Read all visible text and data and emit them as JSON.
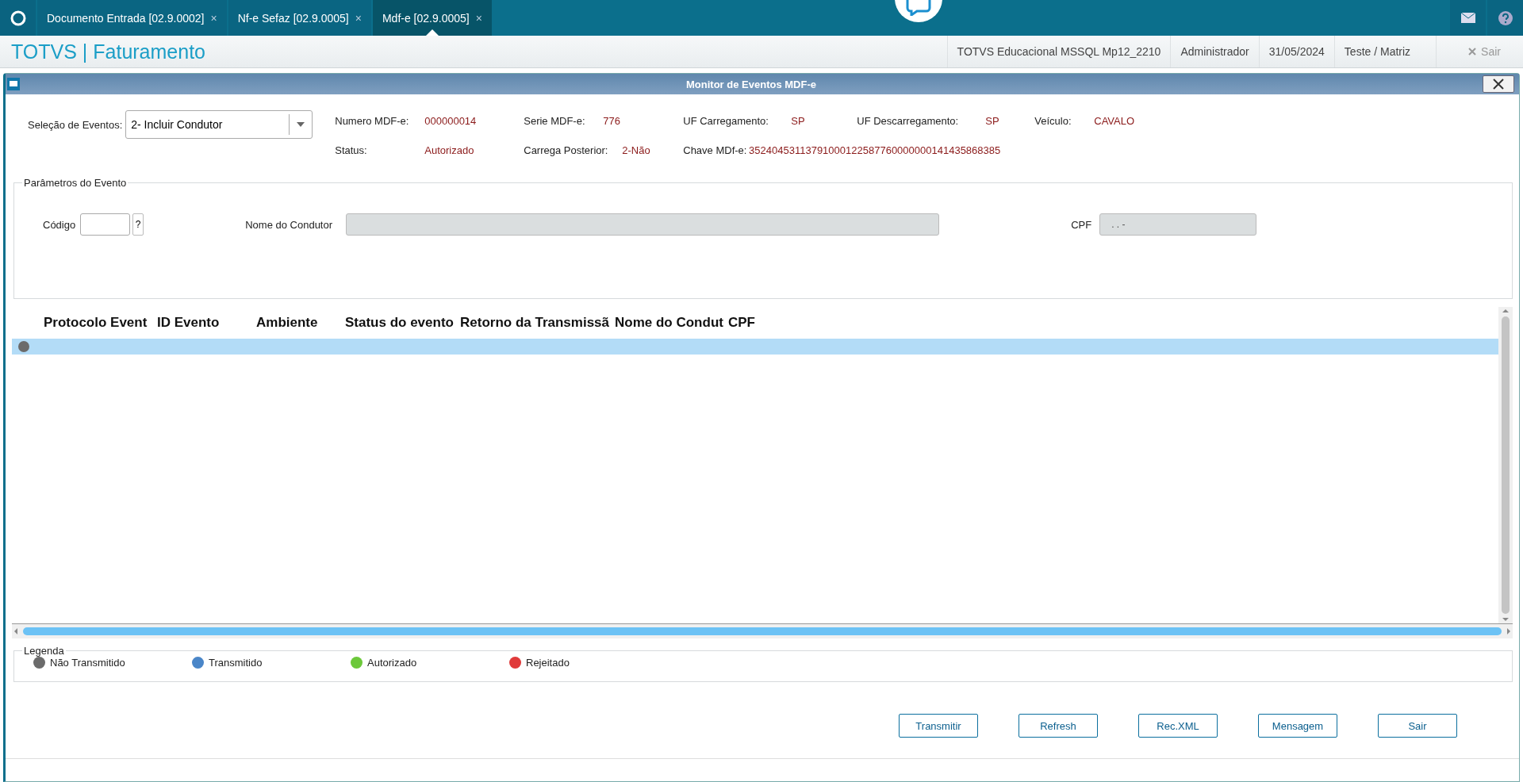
{
  "tabs": [
    {
      "label": "Documento Entrada [02.9.0002]",
      "close": "×",
      "selected": false
    },
    {
      "label": "Nf-e Sefaz [02.9.0005]",
      "close": "×",
      "selected": false
    },
    {
      "label": "Mdf-e [02.9.0005]",
      "close": "×",
      "selected": true
    }
  ],
  "header": {
    "title": "TOTVS | Faturamento",
    "info": [
      "TOTVS Educacional MSSQL Mp12_2210",
      "Administrador",
      "31/05/2024",
      "Teste / Matriz"
    ],
    "exit": "Sair"
  },
  "window": {
    "title": "Monitor de Eventos MDF-e"
  },
  "event_select": {
    "label": "Seleção de Eventos:",
    "value": "2- Incluir Condutor"
  },
  "info_rows": [
    [
      {
        "label": "Numero MDF-e:",
        "value": "000000014"
      },
      {
        "label": "Serie MDF-e:",
        "value": "776"
      },
      {
        "label": "UF Carregamento:",
        "value": "SP"
      },
      {
        "label": "UF Descarregamento:",
        "value": "SP"
      },
      {
        "label": "Veículo:",
        "value": "CAVALO"
      }
    ],
    [
      {
        "label": "Status:",
        "value": "Autorizado"
      },
      {
        "label": "Carrega Posterior:",
        "value": "2-Não"
      },
      {
        "label": "Chave MDf-e:",
        "value": "35240453113791000122587760000000141435868385"
      }
    ]
  ],
  "parameters": {
    "legend": "Parâmetros do Evento",
    "codigo": {
      "label": "Código",
      "lookup": "?"
    },
    "nome": {
      "label": "Nome do Condutor",
      "disabled": true
    },
    "cpf": {
      "label": "CPF",
      "value": ".   .   -",
      "disabled": true
    }
  },
  "table": {
    "columns": [
      "Protocolo Event",
      "ID Evento",
      "Ambiente",
      "Status do evento",
      "Retorno da Transmissã",
      "Nome do Condut",
      "CPF"
    ],
    "rows": [
      {
        "color": "#6b6b6b",
        "selected": true
      }
    ]
  },
  "legend": {
    "title": "Legenda",
    "items": [
      {
        "label": "Não Transmitido",
        "color": "#6b6b6b"
      },
      {
        "label": "Transmitido",
        "color": "#4a86c8"
      },
      {
        "label": "Autorizado",
        "color": "#6cc83a"
      },
      {
        "label": "Rejeitado",
        "color": "#e03a3a"
      }
    ]
  },
  "buttons": [
    "Transmitir",
    "Refresh",
    "Rec.XML",
    "Mensagem",
    "Sair"
  ]
}
